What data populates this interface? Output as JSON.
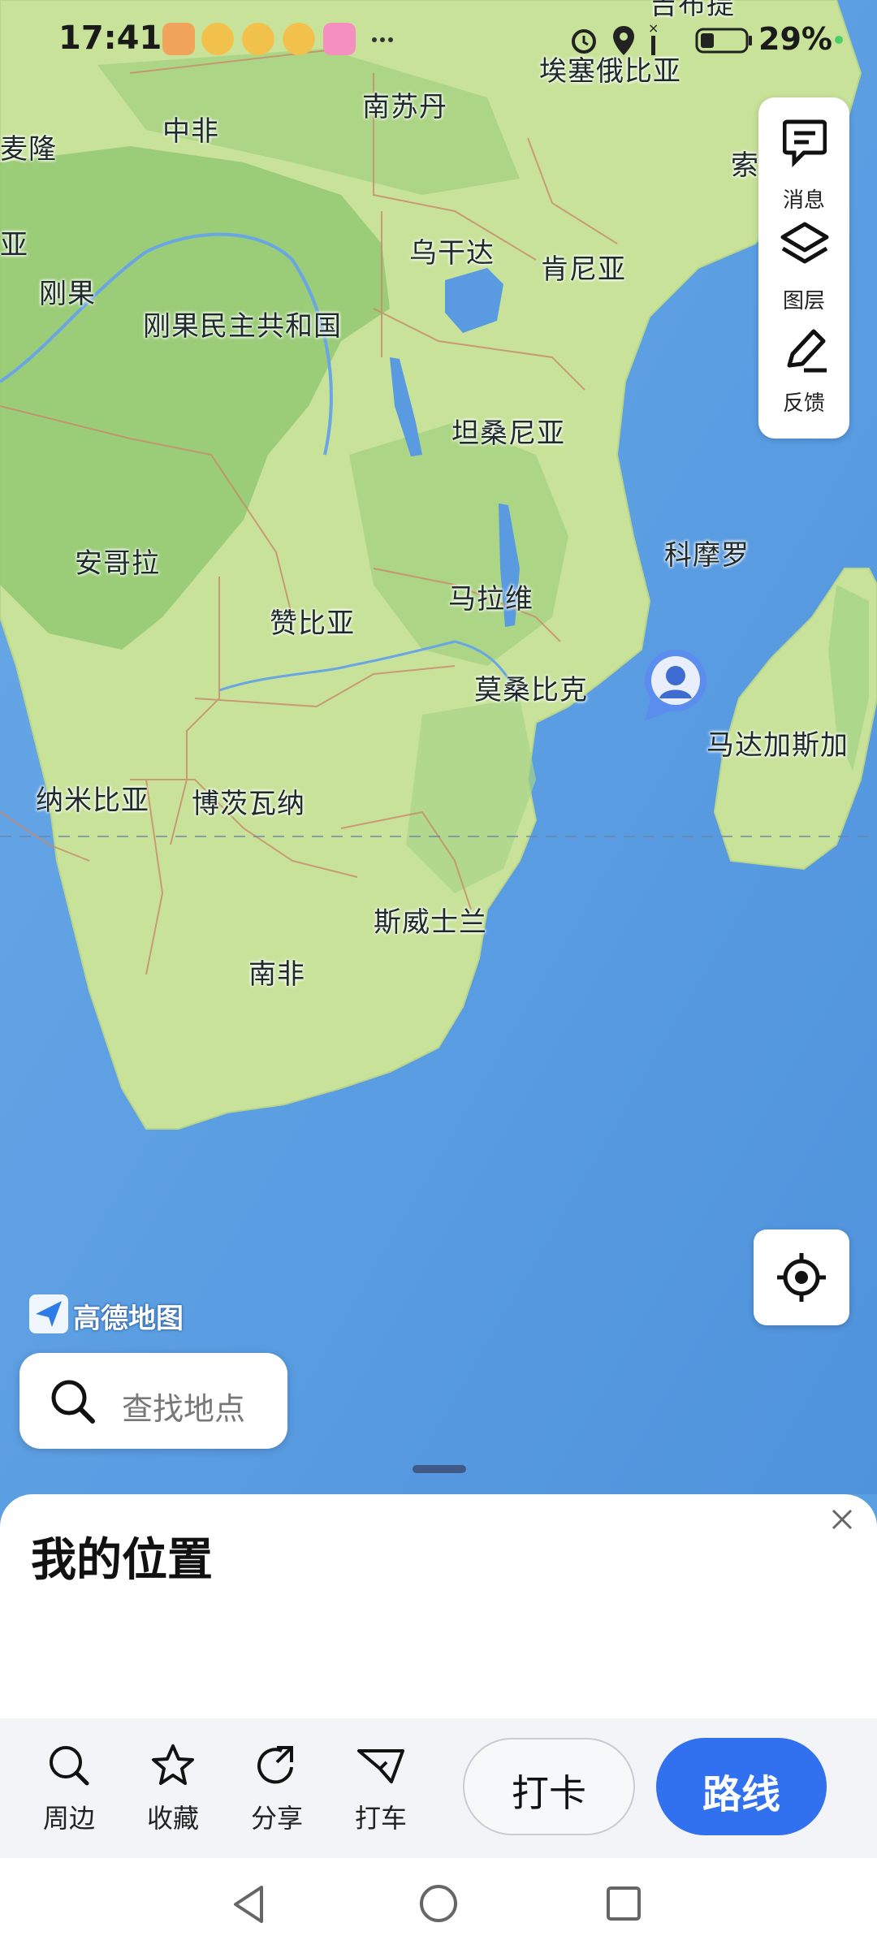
{
  "status_bar": {
    "time": "17:41",
    "battery": "29%"
  },
  "map": {
    "labels": [
      {
        "id": "label-south-sudan",
        "text": "南苏丹"
      },
      {
        "id": "label-central-africa",
        "text": "中非"
      },
      {
        "id": "label-ethiopia",
        "text": "埃塞俄比亚"
      },
      {
        "id": "label-cameroon-partial",
        "text": "麦隆"
      },
      {
        "id": "label-gabon-partial",
        "text": "亚"
      },
      {
        "id": "label-congo",
        "text": "刚果"
      },
      {
        "id": "label-uganda",
        "text": "乌干达"
      },
      {
        "id": "label-kenya",
        "text": "肯尼亚"
      },
      {
        "id": "label-somalia-partial",
        "text": "索"
      },
      {
        "id": "label-drc",
        "text": "刚果民主共和国"
      },
      {
        "id": "label-tanzania",
        "text": "坦桑尼亚"
      },
      {
        "id": "label-angola",
        "text": "安哥拉"
      },
      {
        "id": "label-comoros",
        "text": "科摩罗"
      },
      {
        "id": "label-malawi",
        "text": "马拉维"
      },
      {
        "id": "label-zambia",
        "text": "赞比亚"
      },
      {
        "id": "label-mozambique",
        "text": "莫桑比克"
      },
      {
        "id": "label-madagascar",
        "text": "马达加斯加"
      },
      {
        "id": "label-namibia",
        "text": "纳米比亚"
      },
      {
        "id": "label-botswana",
        "text": "博茨瓦纳"
      },
      {
        "id": "label-eswatini",
        "text": "斯威士兰"
      },
      {
        "id": "label-south-africa",
        "text": "南非"
      },
      {
        "id": "label-djibouti-partial",
        "text": "吉布提"
      }
    ],
    "brand": "高德地图"
  },
  "side_panel": {
    "messages_label": "消息",
    "layers_label": "图层",
    "feedback_label": "反馈"
  },
  "search": {
    "placeholder": "查找地点"
  },
  "sheet": {
    "title": "我的位置",
    "actions": [
      {
        "label": "周边",
        "icon": "search-icon"
      },
      {
        "label": "收藏",
        "icon": "star-icon"
      },
      {
        "label": "分享",
        "icon": "share-icon"
      },
      {
        "label": "打车",
        "icon": "taxi-icon"
      }
    ],
    "punch_label": "打卡",
    "route_label": "路线"
  },
  "colors": {
    "ocean": "#5b9fe3",
    "land": "#c9e39a",
    "forest": "#8dc66e",
    "accent": "#3170ee"
  }
}
